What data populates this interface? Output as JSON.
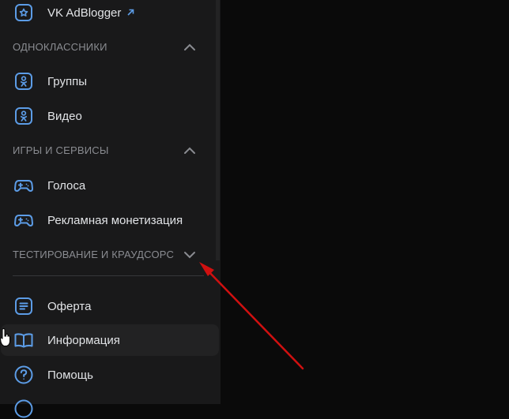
{
  "sidebar": {
    "vk_adblogger": {
      "label": "VK AdBlogger",
      "icon": "vk-adblogger-icon"
    },
    "sections": {
      "ok": {
        "title": "Одноклассники",
        "state": "expanded"
      },
      "games": {
        "title": "Игры и сервисы",
        "state": "expanded"
      },
      "testing": {
        "title": "Тестирование и краудсорсинг",
        "state": "collapsed"
      }
    },
    "ok_items": [
      {
        "label": "Группы",
        "icon": "ok-icon"
      },
      {
        "label": "Видео",
        "icon": "ok-icon"
      }
    ],
    "games_items": [
      {
        "label": "Голоса",
        "icon": "gamepad-icon"
      },
      {
        "label": "Рекламная монетизация",
        "icon": "gamepad-icon"
      }
    ],
    "footer_items": [
      {
        "label": "Оферта",
        "icon": "document-icon"
      },
      {
        "label": "Информация",
        "icon": "book-icon"
      },
      {
        "label": "Помощь",
        "icon": "help-icon"
      }
    ]
  },
  "colors": {
    "accent": "#5c9ce6",
    "sidebar_bg": "#19191a",
    "page_bg": "#0a0a0a",
    "text": "#e1e3e6",
    "section_text": "#8a8c91",
    "annotation_arrow": "#d01010"
  }
}
